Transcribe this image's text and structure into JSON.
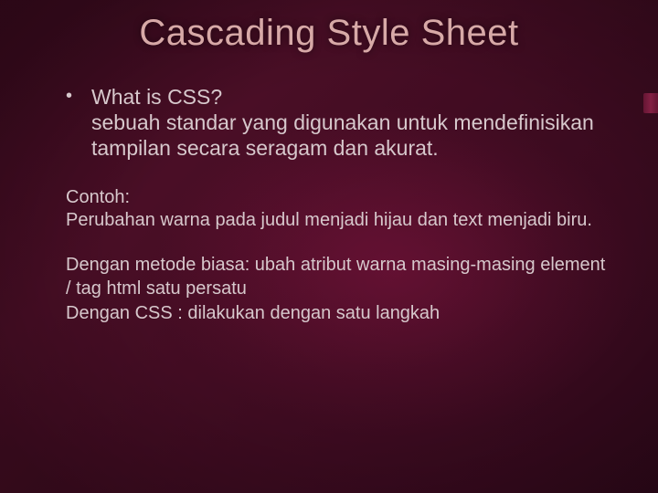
{
  "title": "Cascading Style Sheet",
  "bullet1": {
    "q": "What is CSS?",
    "a": "sebuah standar yang digunakan untuk mendefinisikan tampilan secara seragam dan akurat."
  },
  "example": {
    "label": "Contoh:",
    "text": "Perubahan warna pada judul menjadi hijau dan text menjadi biru."
  },
  "methods": {
    "ordinary": "Dengan metode biasa: ubah atribut warna masing-masing element / tag html satu persatu",
    "css": "Dengan CSS : dilakukan dengan satu langkah"
  }
}
